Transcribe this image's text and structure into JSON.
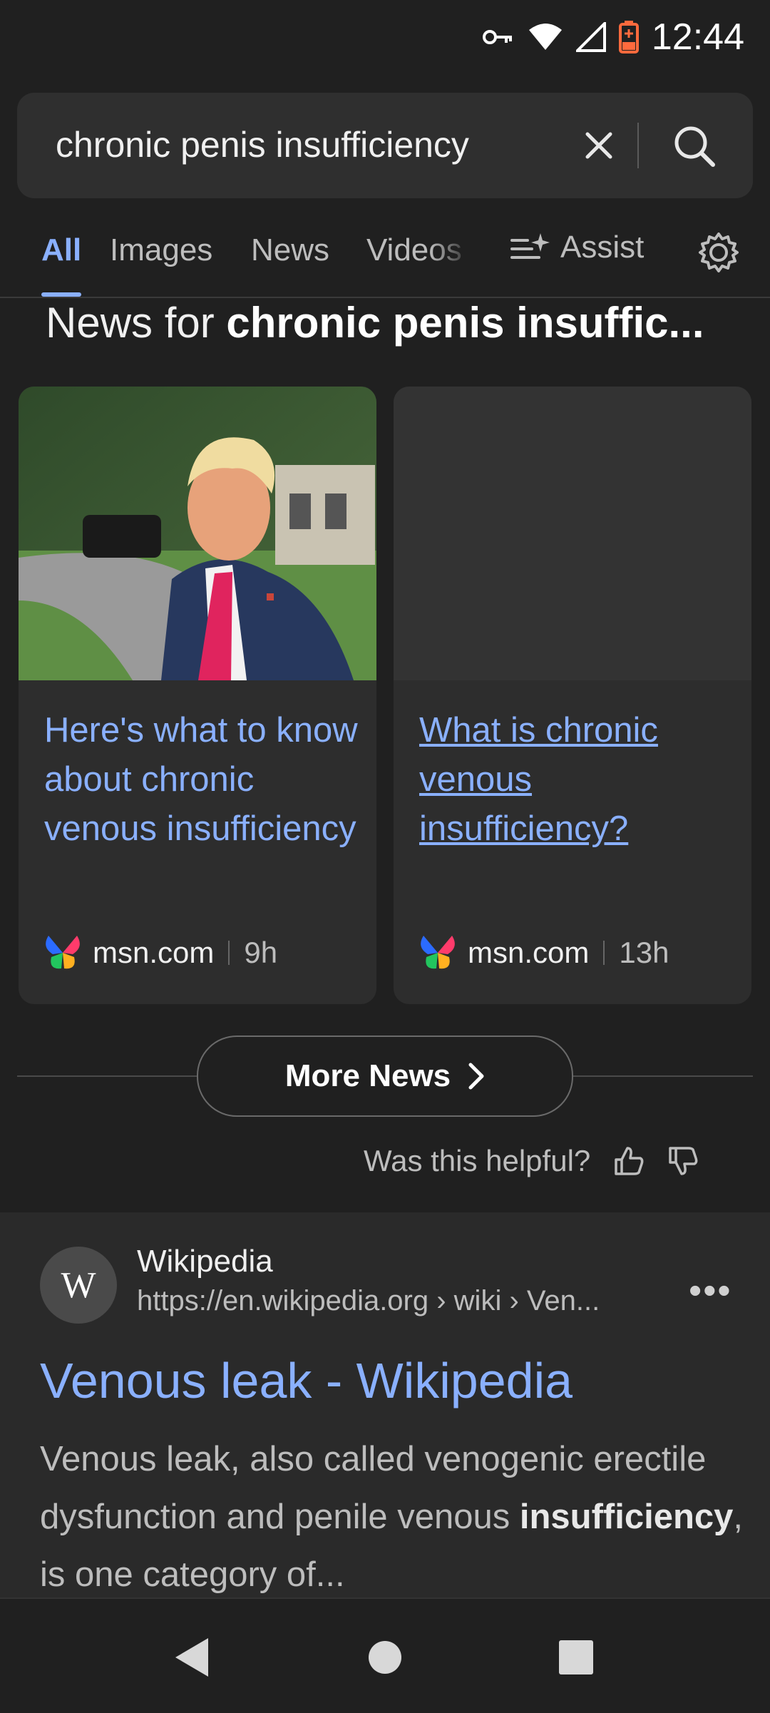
{
  "status_bar": {
    "time": "12:44",
    "icons": [
      "vpn-key-icon",
      "wifi-icon",
      "signal-icon",
      "battery-charging-icon"
    ]
  },
  "search": {
    "query": "chronic penis insufficiency"
  },
  "tabs": [
    {
      "label": "All",
      "active": true
    },
    {
      "label": "Images"
    },
    {
      "label": "News"
    },
    {
      "label": "Videos"
    }
  ],
  "assist_label": "Assist",
  "news": {
    "heading_prefix": "News for ",
    "heading_query": "chronic penis insuffic...",
    "cards": [
      {
        "title": "Here's what to know about chronic venous insufficiency",
        "source": "msn.com",
        "age": "9h",
        "has_image": true
      },
      {
        "title": "What is chronic venous insufficiency?",
        "source": "msn.com",
        "age": "13h",
        "has_image": false
      }
    ],
    "more_label": "More News"
  },
  "feedback": {
    "prompt": "Was this helpful?"
  },
  "result": {
    "logo_letter": "W",
    "site_name": "Wikipedia",
    "url": "https://en.wikipedia.org › wiki › Ven...",
    "title": "Venous leak - Wikipedia",
    "snippet_start": "Venous leak, also called venogenic erectile dysfunction and penile venous ",
    "snippet_bold": "insufficiency",
    "snippet_end": ", is one category of..."
  },
  "colors": {
    "accent": "#8ab0ff",
    "background": "#202020",
    "card": "#2d2d2d"
  }
}
